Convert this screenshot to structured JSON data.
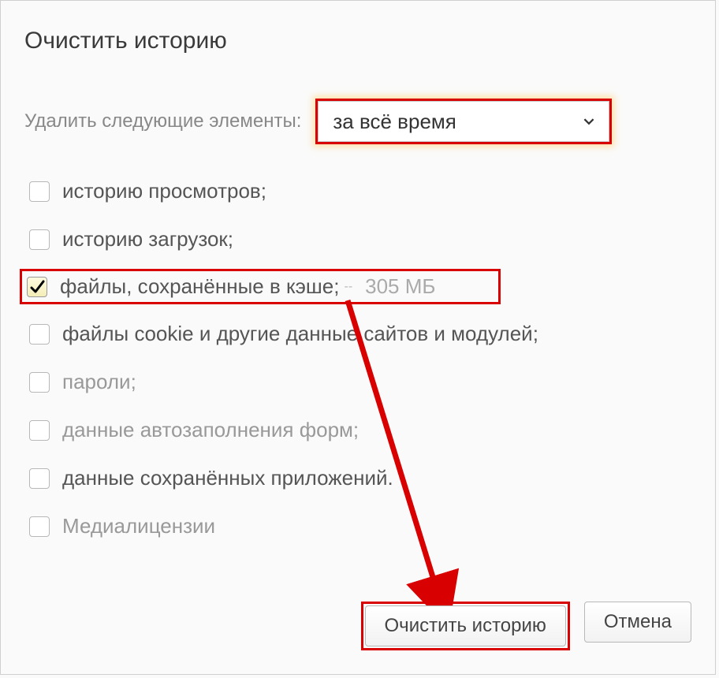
{
  "dialog": {
    "title": "Очистить историю",
    "delete_label": "Удалить следующие элементы:",
    "time_range": "за всё время"
  },
  "options": [
    {
      "label": "историю просмотров;",
      "checked": false,
      "dim": false
    },
    {
      "label": "историю загрузок;",
      "checked": false,
      "dim": false
    },
    {
      "label": "файлы, сохранённые в кэше;",
      "checked": true,
      "dim": false,
      "extra_sep": "--",
      "extra": "305 МБ",
      "highlight": true
    },
    {
      "label": "файлы cookie и другие данные сайтов и модулей;",
      "checked": false,
      "dim": false
    },
    {
      "label": "пароли;",
      "checked": false,
      "dim": true
    },
    {
      "label": "данные автозаполнения форм;",
      "checked": false,
      "dim": true
    },
    {
      "label": "данные сохранённых приложений.",
      "checked": false,
      "dim": false
    },
    {
      "label": "Медиалицензии",
      "checked": false,
      "dim": true
    }
  ],
  "buttons": {
    "clear": "Очистить историю",
    "cancel": "Отмена"
  },
  "annotations": {
    "highlight_color": "#d80000"
  }
}
